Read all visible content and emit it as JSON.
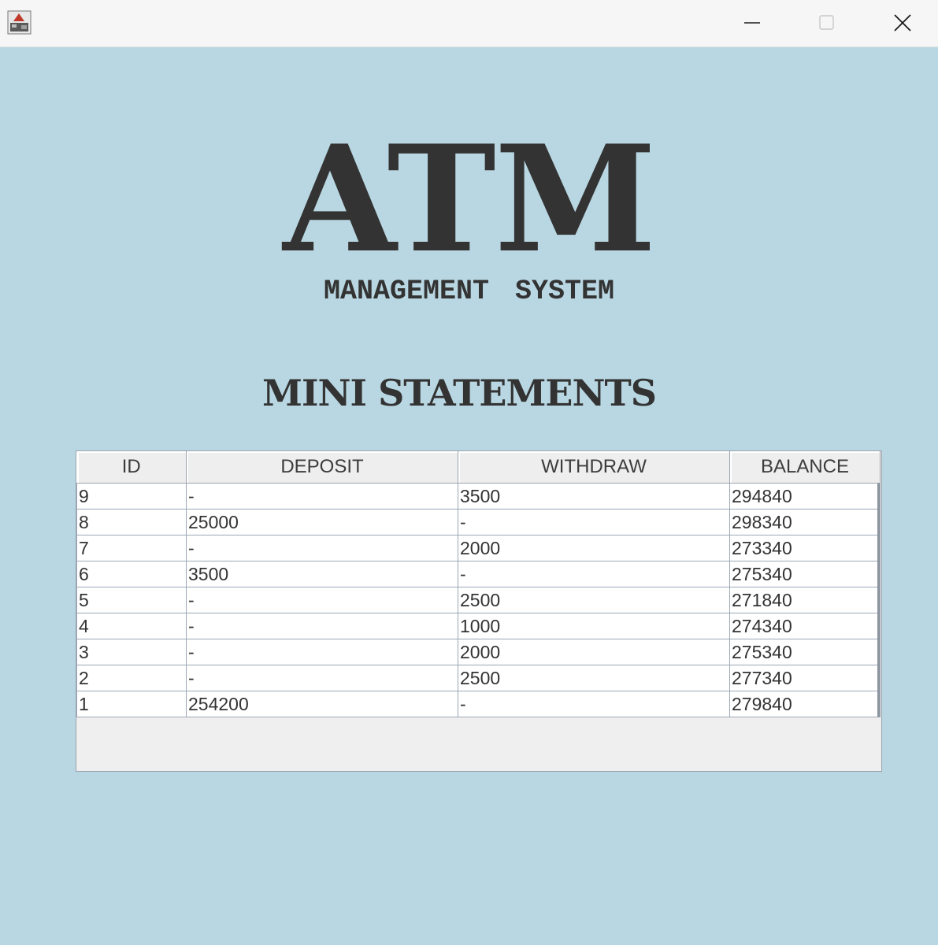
{
  "window": {
    "minimize_icon": "minimize-icon",
    "maximize_icon": "maximize-icon",
    "close_icon": "close-icon",
    "app_icon": "java-app-icon"
  },
  "logo": {
    "title": "ATM",
    "subtitle": "MANAGEMENT SYSTEM"
  },
  "section_title": "MINI STATEMENTS",
  "table": {
    "columns": [
      "ID",
      "DEPOSIT",
      "WITHDRAW",
      "BALANCE"
    ],
    "rows": [
      [
        "9",
        "-",
        "3500",
        "294840"
      ],
      [
        "8",
        "25000",
        "-",
        "298340"
      ],
      [
        "7",
        "-",
        "2000",
        "273340"
      ],
      [
        "6",
        "3500",
        "-",
        "275340"
      ],
      [
        "5",
        "-",
        "2500",
        "271840"
      ],
      [
        "4",
        "-",
        "1000",
        "274340"
      ],
      [
        "3",
        "-",
        "2000",
        "275340"
      ],
      [
        "2",
        "-",
        "2500",
        "277340"
      ],
      [
        "1",
        "254200",
        "-",
        "279840"
      ]
    ]
  },
  "colors": {
    "background": "#b9d7e2",
    "text": "#333333",
    "titlebar": "#f6f6f7"
  }
}
